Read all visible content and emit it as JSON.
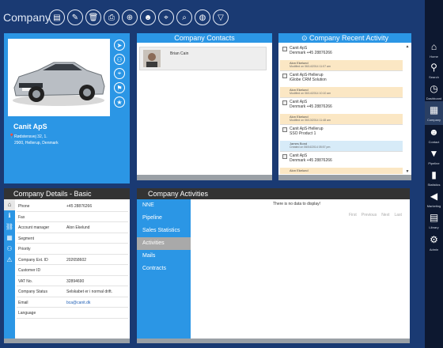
{
  "app": {
    "title": "Company"
  },
  "toolbar": {
    "icons": [
      "new-document-icon",
      "edit-document-icon",
      "delete-icon",
      "print-icon",
      "add-contact-icon",
      "person-icon",
      "location-icon",
      "search-location-icon",
      "globe-icon",
      "filter-icon"
    ]
  },
  "company": {
    "name": "Canit ApS",
    "address_line1": "Rødstensvej 32, 1.",
    "address_line2": "2900, Hellerup, Denmark",
    "side_actions": [
      "navigate-icon",
      "add-group-icon",
      "location-icon",
      "flag-icon",
      "star-icon"
    ]
  },
  "contacts": {
    "title": "Company Contacts",
    "items": [
      {
        "name": "Brian Cain"
      }
    ]
  },
  "activity": {
    "title": "Company Recent Activity",
    "items": [
      {
        "l1": "Canit ApS",
        "l2": "Denmark +45 28876266",
        "l3": "Alon Ekelund",
        "l4": "Modified on 06/14/2014 11:07 am",
        "tone": "orange"
      },
      {
        "l1": "Canit ApS-Hellerup",
        "l2": "iGlobe CRM Solution",
        "l3": "Alon Ekelund",
        "l4": "Modified on 06/14/2014 10:10 am",
        "tone": "orange"
      },
      {
        "l1": "Canit ApS",
        "l2": "Denmark +45 28876266",
        "l3": "Alon Ekelund",
        "l4": "Modified on 06/13/2014 11:48 am",
        "tone": "orange"
      },
      {
        "l1": "Canit ApS-Hellerup",
        "l2": "SSO Product 1",
        "l3": "James Bond",
        "l4": "Created on 06/04/2014 05:57 pm",
        "tone": "blue"
      },
      {
        "l1": "Canit ApS",
        "l2": "Denmark +45 28876266",
        "l3": "Alon Ekelund",
        "l4": "",
        "tone": "orange"
      }
    ]
  },
  "details": {
    "title": "Company Details - Basic",
    "rows": [
      {
        "label": "Phone",
        "value": "+45 28876266"
      },
      {
        "label": "Fax",
        "value": ""
      },
      {
        "label": "Account manager",
        "value": "Alon Ekelund"
      },
      {
        "label": "Segment",
        "value": ""
      },
      {
        "label": "Priority",
        "value": ""
      },
      {
        "label": "Company Ext. ID",
        "value": "202658602"
      },
      {
        "label": "Customer ID",
        "value": ""
      },
      {
        "label": "VAT No.",
        "value": "32894690"
      },
      {
        "label": "Company Status",
        "value": "Selskabet er i normal drift."
      },
      {
        "label": "Email",
        "value": "bca@canit.dk"
      },
      {
        "label": "Language",
        "value": ""
      }
    ]
  },
  "activities": {
    "title": "Company Activities",
    "menu": [
      "NNE",
      "Pipeline",
      "Sales Statistics",
      "Activities",
      "Mails",
      "Contracts"
    ],
    "active_index": 3,
    "empty_text": "There is no data to display!",
    "pager": {
      "first": "First",
      "previous": "Previous",
      "next": "Next",
      "last": "Last"
    }
  },
  "rightnav": {
    "items": [
      {
        "label": "Home",
        "icon": "home-icon"
      },
      {
        "label": "Search",
        "icon": "search-icon"
      },
      {
        "label": "Dashboard",
        "icon": "dashboard-icon"
      },
      {
        "label": "Company",
        "icon": "company-icon"
      },
      {
        "label": "Contact",
        "icon": "contact-icon"
      },
      {
        "label": "Pipeline",
        "icon": "pipeline-icon"
      },
      {
        "label": "Statistics",
        "icon": "statistics-icon"
      },
      {
        "label": "Marketing",
        "icon": "marketing-icon"
      },
      {
        "label": "Library",
        "icon": "library-icon"
      },
      {
        "label": "Admin",
        "icon": "admin-icon"
      }
    ],
    "active_index": 3
  },
  "colors": {
    "background": "#1a3a73",
    "accent": "#2b96e5",
    "dark_header": "#333333",
    "orange_row": "#fbe7c4",
    "blue_row": "#d7ebf8"
  }
}
